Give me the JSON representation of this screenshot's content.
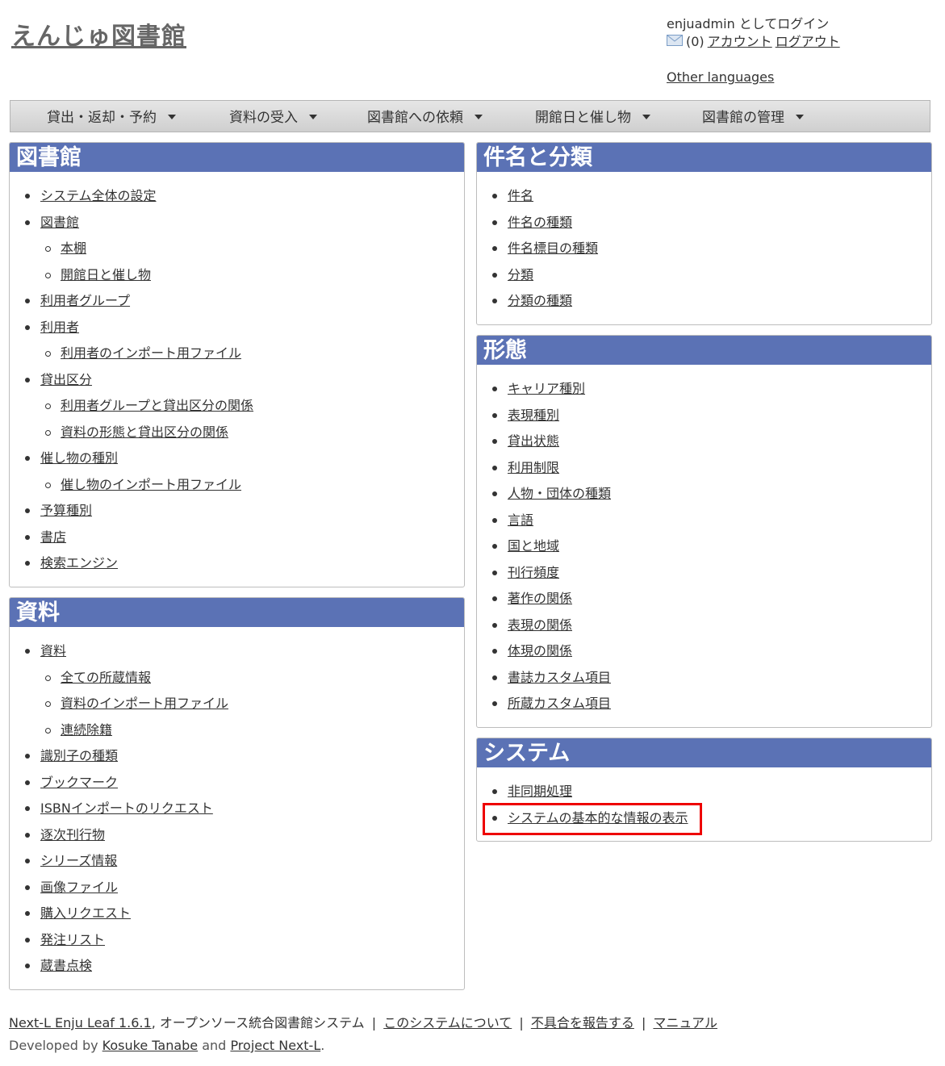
{
  "site": {
    "title": "えんじゅ図書館"
  },
  "account": {
    "login_text": "enjuadmin としてログイン",
    "message_count": "(0)",
    "account_link": "アカウント",
    "logout_link": "ログアウト",
    "other_languages": "Other languages"
  },
  "menu": [
    {
      "label": "貸出・返却・予約"
    },
    {
      "label": "資料の受入"
    },
    {
      "label": "図書館への依頼"
    },
    {
      "label": "開館日と催し物"
    },
    {
      "label": "図書館の管理"
    }
  ],
  "panels": {
    "library": {
      "title": "図書館",
      "items": [
        {
          "label": "システム全体の設定",
          "level": 1
        },
        {
          "label": "図書館",
          "level": 1
        },
        {
          "label": "本棚",
          "level": 2
        },
        {
          "label": "開館日と催し物",
          "level": 2
        },
        {
          "label": "利用者グループ",
          "level": 1
        },
        {
          "label": "利用者",
          "level": 1
        },
        {
          "label": "利用者のインポート用ファイル",
          "level": 2
        },
        {
          "label": "貸出区分",
          "level": 1
        },
        {
          "label": "利用者グループと貸出区分の関係",
          "level": 2
        },
        {
          "label": "資料の形態と貸出区分の関係",
          "level": 2
        },
        {
          "label": "催し物の種別",
          "level": 1
        },
        {
          "label": "催し物のインポート用ファイル",
          "level": 2
        },
        {
          "label": "予算種別",
          "level": 1
        },
        {
          "label": "書店",
          "level": 1
        },
        {
          "label": "検索エンジン",
          "level": 1
        }
      ]
    },
    "materials": {
      "title": "資料",
      "items": [
        {
          "label": "資料",
          "level": 1
        },
        {
          "label": "全ての所蔵情報",
          "level": 2
        },
        {
          "label": "資料のインポート用ファイル",
          "level": 2
        },
        {
          "label": "連続除籍",
          "level": 2
        },
        {
          "label": "識別子の種類",
          "level": 1
        },
        {
          "label": "ブックマーク",
          "level": 1
        },
        {
          "label": "ISBNインポートのリクエスト",
          "level": 1
        },
        {
          "label": "逐次刊行物",
          "level": 1
        },
        {
          "label": "シリーズ情報",
          "level": 1
        },
        {
          "label": "画像ファイル",
          "level": 1
        },
        {
          "label": "購入リクエスト",
          "level": 1
        },
        {
          "label": "発注リスト",
          "level": 1
        },
        {
          "label": "蔵書点検",
          "level": 1
        }
      ]
    },
    "subjects": {
      "title": "件名と分類",
      "items": [
        {
          "label": "件名",
          "level": 1
        },
        {
          "label": "件名の種類",
          "level": 1
        },
        {
          "label": "件名標目の種類",
          "level": 1
        },
        {
          "label": "分類",
          "level": 1
        },
        {
          "label": "分類の種類",
          "level": 1
        }
      ]
    },
    "forms": {
      "title": "形態",
      "items": [
        {
          "label": "キャリア種別",
          "level": 1
        },
        {
          "label": "表現種別",
          "level": 1
        },
        {
          "label": "貸出状態",
          "level": 1
        },
        {
          "label": "利用制限",
          "level": 1
        },
        {
          "label": "人物・団体の種類",
          "level": 1
        },
        {
          "label": "言語",
          "level": 1
        },
        {
          "label": "国と地域",
          "level": 1
        },
        {
          "label": "刊行頻度",
          "level": 1
        },
        {
          "label": "著作の関係",
          "level": 1
        },
        {
          "label": "表現の関係",
          "level": 1
        },
        {
          "label": "体現の関係",
          "level": 1
        },
        {
          "label": "書誌カスタム項目",
          "level": 1
        },
        {
          "label": "所蔵カスタム項目",
          "level": 1
        }
      ]
    },
    "system": {
      "title": "システム",
      "items": [
        {
          "label": "非同期処理",
          "level": 1
        },
        {
          "label": "システムの基本的な情報の表示",
          "level": 1
        }
      ]
    }
  },
  "footer": {
    "product_link": "Next-L Enju Leaf 1.6.1",
    "product_desc": ", オープンソース統合図書館システム",
    "separator": "|",
    "about_link": "このシステムについて",
    "report_link": "不具合を報告する",
    "manual_link": "マニュアル",
    "developed_by": "Developed by",
    "author_link": "Kosuke Tanabe",
    "and_text": "and",
    "project_link": "Project Next-L",
    "period": "."
  },
  "colors": {
    "panel_header": "#5b72b5",
    "highlight": "#ee0000",
    "menubar": "#d9d9d9"
  },
  "icons": {
    "mail": "mail-icon",
    "caret": "chevron-down-icon"
  }
}
